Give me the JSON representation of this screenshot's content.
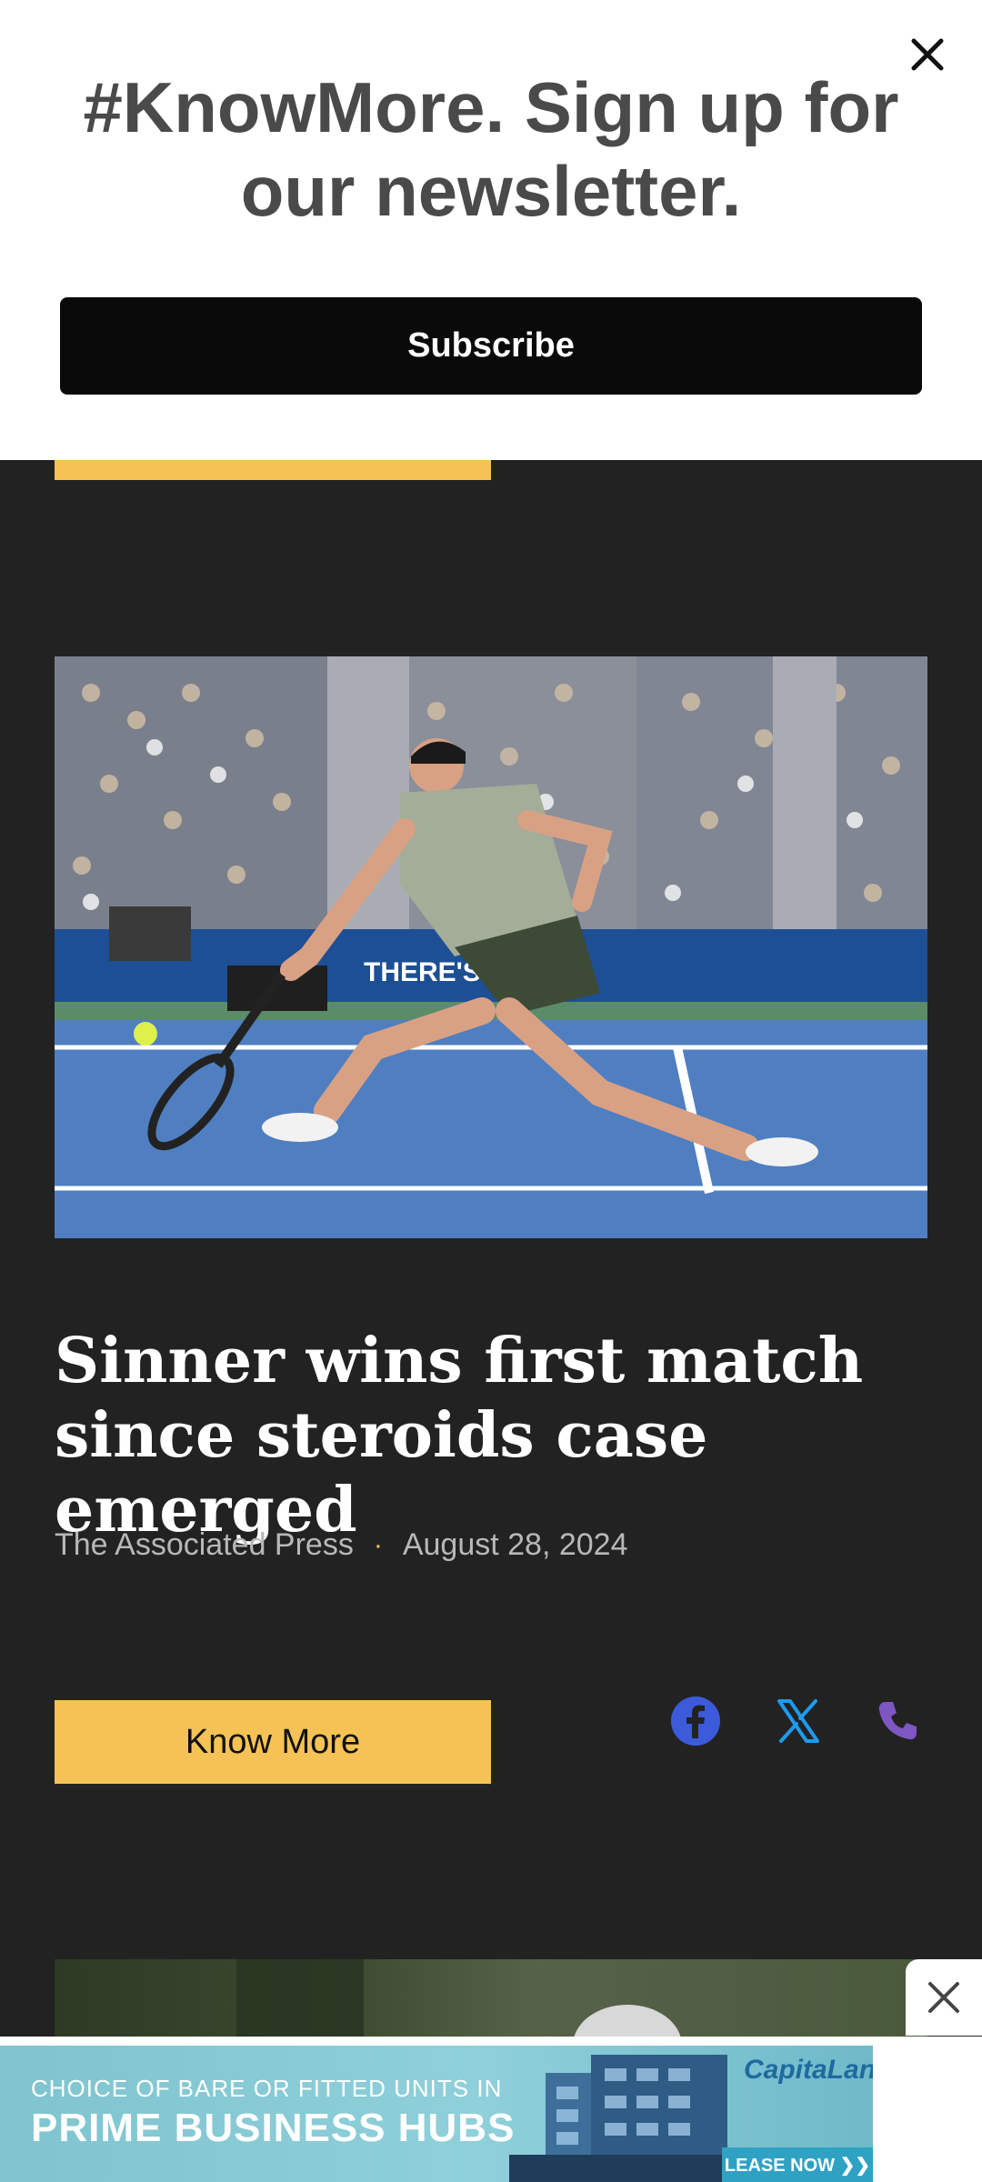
{
  "newsletter": {
    "title": "#KnowMore. Sign up for our newsletter.",
    "subscribe_label": "Subscribe"
  },
  "article": {
    "headline": "Sinner wins first match since steroids case emerged",
    "source": "The Associated Press",
    "separator": "·",
    "date": "August 28, 2024",
    "know_more_label": "Know More",
    "image_banner_text": "THERE'S"
  },
  "share": {
    "facebook_color": "#3b5bdb",
    "x_color": "#1d9bf0",
    "phone_color": "#7e57c2"
  },
  "ad": {
    "line1": "CHOICE OF BARE OR FITTED UNITS IN",
    "line2": "PRIME BUSINESS HUBS",
    "brand": "CapitaLand",
    "cta": "LEASE NOW ❯❯"
  },
  "colors": {
    "accent": "#f5c255",
    "background": "#222223"
  }
}
